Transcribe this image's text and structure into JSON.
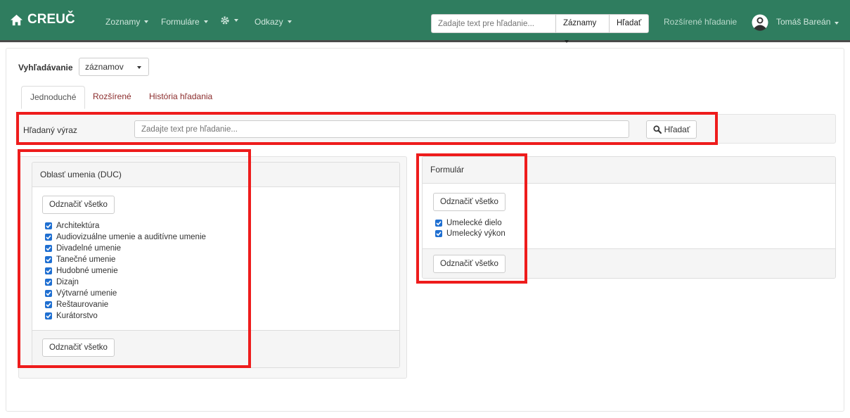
{
  "colors": {
    "navbar": "#2f7d5f",
    "link": "#8b2c2c",
    "checkbox": "#1f6fd1",
    "highlight": "#ee1c1c"
  },
  "navbar": {
    "brand": "CREUČ",
    "brand_icon": "home-icon",
    "menus": [
      "Zoznamy",
      "Formuláre",
      "Odkazy"
    ],
    "settings_icon": "gear-icon",
    "search_placeholder": "Zadajte text pre hľadanie...",
    "search_scope": "Záznamy",
    "search_button": "Hľadať",
    "advanced_link": "Rozšírené hľadanie",
    "user_icon": "user-avatar-icon",
    "user_name": "Tomáš Bareán"
  },
  "search": {
    "label": "Vyhľadávanie",
    "type_value": "záznamov"
  },
  "tabs": [
    "Jednoduché",
    "Rozšírené",
    "História hľadania"
  ],
  "query": {
    "label": "Hľadaný výraz",
    "placeholder": "Zadajte text pre hľadanie...",
    "button": "Hľadať",
    "button_icon": "search-icon"
  },
  "area_panel": {
    "title": "Oblasť umenia (DUC)",
    "select_all": "Odznačiť všetko",
    "items": [
      "Architektúra",
      "Audiovizuálne umenie a auditívne umenie",
      "Divadelné umenie",
      "Tanečné umenie",
      "Hudobné umenie",
      "Dizajn",
      "Výtvarné umenie",
      "Reštaurovanie",
      "Kurátorstvo"
    ]
  },
  "form_panel": {
    "title": "Formulár",
    "select_all": "Odznačiť všetko",
    "items": [
      "Umelecké dielo",
      "Umelecký výkon"
    ]
  }
}
